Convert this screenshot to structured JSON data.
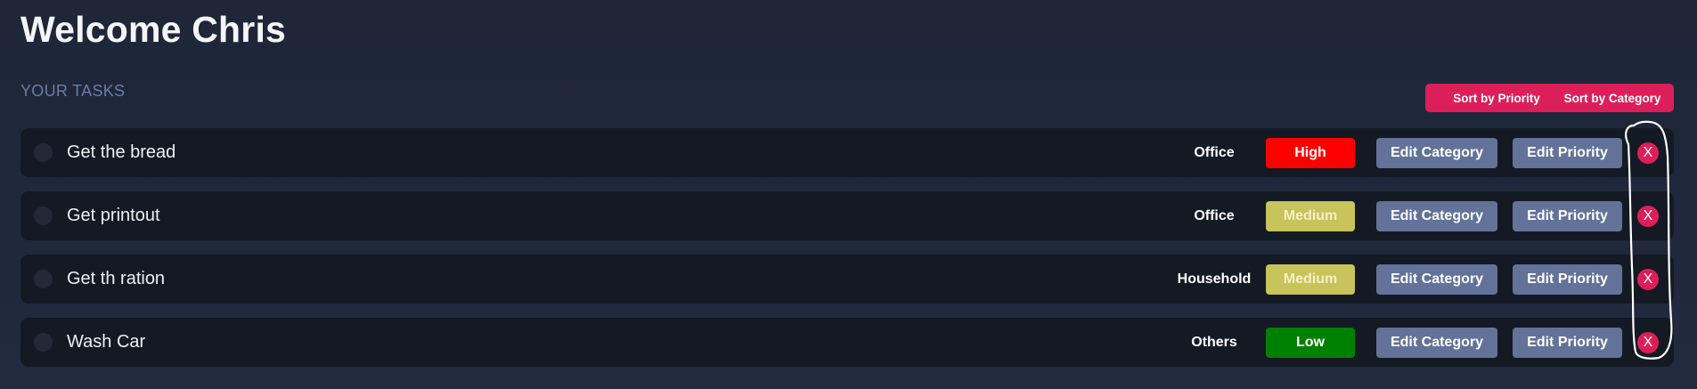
{
  "header": {
    "welcome": "Welcome Chris",
    "section_label": "YOUR TASKS"
  },
  "toolbar": {
    "sort_priority_label": "Sort by Priority",
    "sort_category_label": "Sort by Category"
  },
  "tasks": [
    {
      "title": "Get the bread",
      "category": "Office",
      "priority": "High",
      "edit_category_label": "Edit Category",
      "edit_priority_label": "Edit Priority",
      "delete_label": "X"
    },
    {
      "title": "Get printout",
      "category": "Office",
      "priority": "Medium",
      "edit_category_label": "Edit Category",
      "edit_priority_label": "Edit Priority",
      "delete_label": "X"
    },
    {
      "title": "Get th ration",
      "category": "Household",
      "priority": "Medium",
      "edit_category_label": "Edit Category",
      "edit_priority_label": "Edit Priority",
      "delete_label": "X"
    },
    {
      "title": "Wash Car",
      "category": "Others",
      "priority": "Low",
      "edit_category_label": "Edit Category",
      "edit_priority_label": "Edit Priority",
      "delete_label": "X"
    }
  ],
  "colors": {
    "background": "#1e2638",
    "row_background": "#141a24",
    "accent": "#dc1f5a",
    "edit_button": "#627299",
    "priority_high": "#ff0000",
    "priority_medium": "#c8c35a",
    "priority_low": "#008000",
    "section_label": "#6a7bab",
    "annotation_stroke": "#ffffff"
  }
}
